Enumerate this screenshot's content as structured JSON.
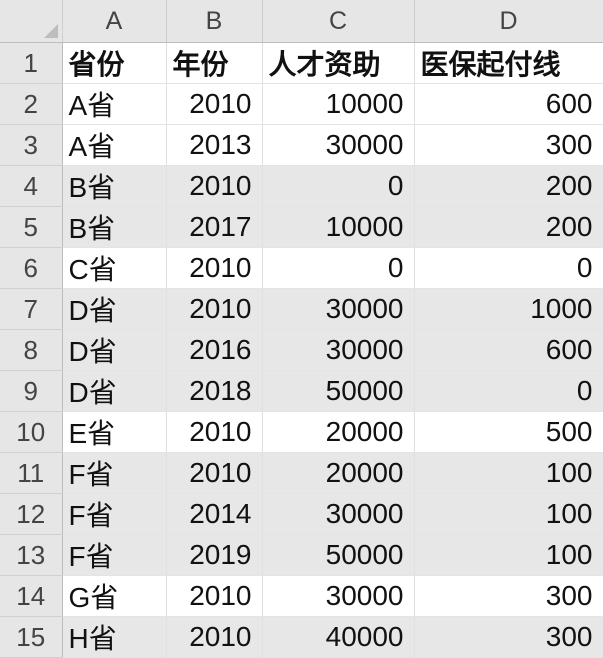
{
  "columns": [
    "A",
    "B",
    "C",
    "D"
  ],
  "header_row": {
    "row_number": "1",
    "cells": [
      "省份",
      "年份",
      "人才资助",
      "医保起付线"
    ]
  },
  "rows": [
    {
      "row_number": "2",
      "province": "A省",
      "year": "2010",
      "talent_funding": "10000",
      "medical_deductible": "600"
    },
    {
      "row_number": "3",
      "province": "A省",
      "year": "2013",
      "talent_funding": "30000",
      "medical_deductible": "300"
    },
    {
      "row_number": "4",
      "province": "B省",
      "year": "2010",
      "talent_funding": "0",
      "medical_deductible": "200"
    },
    {
      "row_number": "5",
      "province": "B省",
      "year": "2017",
      "talent_funding": "10000",
      "medical_deductible": "200"
    },
    {
      "row_number": "6",
      "province": "C省",
      "year": "2010",
      "talent_funding": "0",
      "medical_deductible": "0"
    },
    {
      "row_number": "7",
      "province": "D省",
      "year": "2010",
      "talent_funding": "30000",
      "medical_deductible": "1000"
    },
    {
      "row_number": "8",
      "province": "D省",
      "year": "2016",
      "talent_funding": "30000",
      "medical_deductible": "600"
    },
    {
      "row_number": "9",
      "province": "D省",
      "year": "2018",
      "talent_funding": "50000",
      "medical_deductible": "0"
    },
    {
      "row_number": "10",
      "province": "E省",
      "year": "2010",
      "talent_funding": "20000",
      "medical_deductible": "500"
    },
    {
      "row_number": "11",
      "province": "F省",
      "year": "2010",
      "talent_funding": "20000",
      "medical_deductible": "100"
    },
    {
      "row_number": "12",
      "province": "F省",
      "year": "2014",
      "talent_funding": "30000",
      "medical_deductible": "100"
    },
    {
      "row_number": "13",
      "province": "F省",
      "year": "2019",
      "talent_funding": "50000",
      "medical_deductible": "100"
    },
    {
      "row_number": "14",
      "province": "G省",
      "year": "2010",
      "talent_funding": "30000",
      "medical_deductible": "300"
    },
    {
      "row_number": "15",
      "province": "H省",
      "year": "2010",
      "talent_funding": "40000",
      "medical_deductible": "300"
    }
  ],
  "colors": {
    "shaded_row": "#e7e7e7",
    "plain_row": "#ffffff",
    "header_bg": "#e6e6e6"
  }
}
